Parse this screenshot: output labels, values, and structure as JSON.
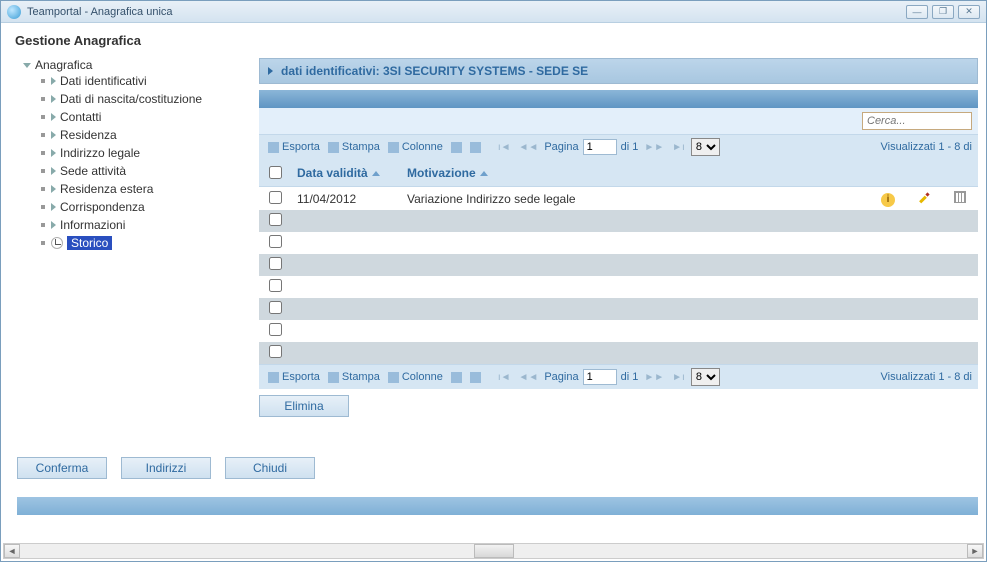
{
  "window": {
    "title": "Teamportal - Anagrafica unica"
  },
  "section_title": "Gestione Anagrafica",
  "tree": {
    "root": "Anagrafica",
    "items": [
      "Dati identificativi",
      "Dati di nascita/costituzione",
      "Contatti",
      "Residenza",
      "Indirizzo legale",
      "Sede attività",
      "Residenza estera",
      "Corrispondenza",
      "Informazioni",
      "Storico"
    ],
    "selected_index": 9
  },
  "panel": {
    "header": "dati identificativi: 3SI SECURITY SYSTEMS - SEDE SE"
  },
  "search": {
    "placeholder": "Cerca..."
  },
  "toolbar": {
    "export": "Esporta",
    "print": "Stampa",
    "columns": "Colonne",
    "page_label": "Pagina",
    "page_value": "1",
    "of": "di 1",
    "pagesize": "8",
    "visual": "Visualizzati 1 - 8 di"
  },
  "table": {
    "headers": {
      "date": "Data validità",
      "motive": "Motivazione"
    },
    "rows": [
      {
        "date": "11/04/2012",
        "motive": "Variazione Indirizzo sede legale",
        "info": true,
        "edit": true,
        "del": true
      },
      {
        "date": "",
        "motive": ""
      },
      {
        "date": "",
        "motive": ""
      },
      {
        "date": "",
        "motive": ""
      },
      {
        "date": "",
        "motive": ""
      },
      {
        "date": "",
        "motive": ""
      },
      {
        "date": "",
        "motive": ""
      },
      {
        "date": "",
        "motive": ""
      }
    ]
  },
  "buttons": {
    "elimina": "Elimina",
    "conferma": "Conferma",
    "indirizzi": "Indirizzi",
    "chiudi": "Chiudi"
  }
}
